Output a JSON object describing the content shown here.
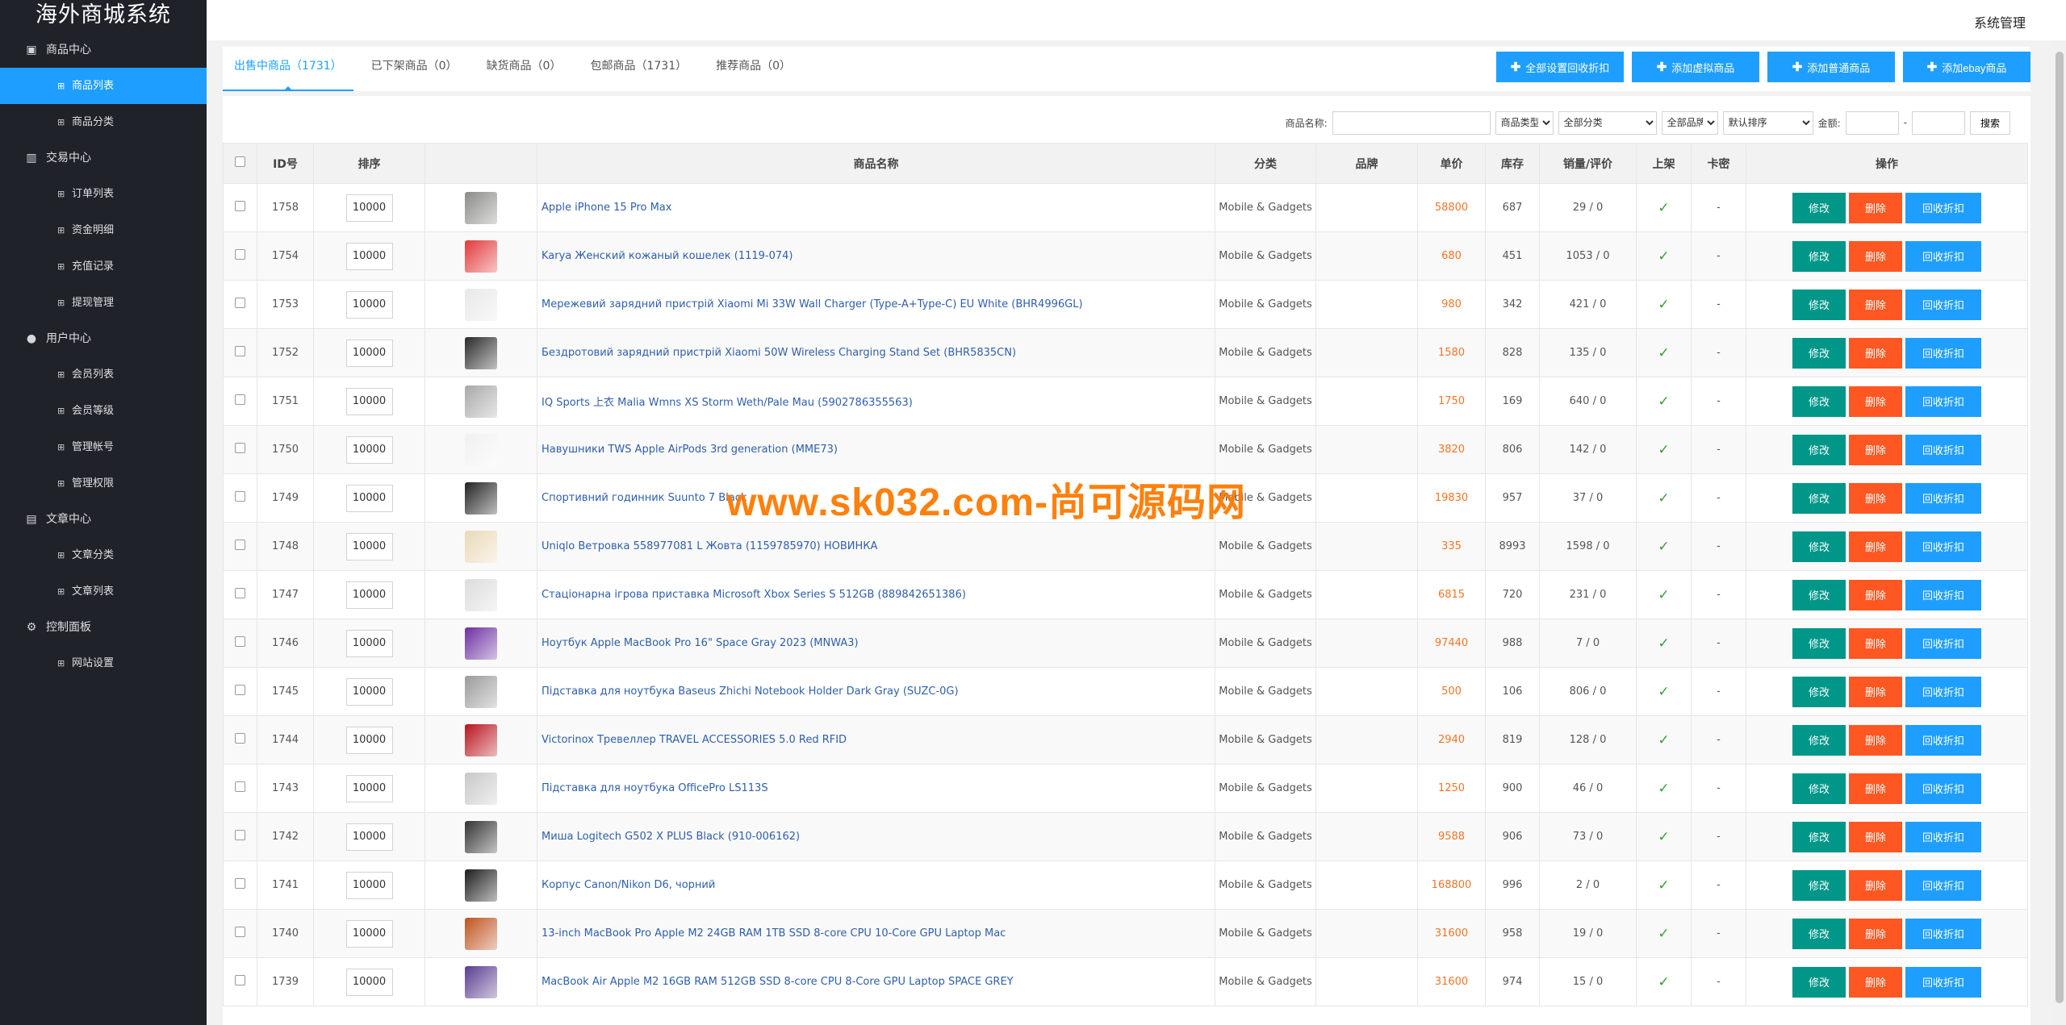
{
  "app": {
    "title": "海外商城系统",
    "sys_admin": "系统管理"
  },
  "sidebar": [
    {
      "title": "商品中心",
      "icon": "goods-icon",
      "glyph": "▣",
      "items": [
        "商品列表",
        "商品分类"
      ]
    },
    {
      "title": "交易中心",
      "icon": "chart-icon",
      "glyph": "▥",
      "items": [
        "订单列表",
        "资金明细",
        "充值记录",
        "提现管理"
      ]
    },
    {
      "title": "用户中心",
      "icon": "user-icon",
      "glyph": "●",
      "items": [
        "会员列表",
        "会员等级",
        "管理帐号",
        "管理权限"
      ]
    },
    {
      "title": "文章中心",
      "icon": "document-icon",
      "glyph": "▤",
      "items": [
        "文章分类",
        "文章列表"
      ]
    },
    {
      "title": "控制面板",
      "icon": "gear-icon",
      "glyph": "⚙",
      "items": [
        "网站设置"
      ]
    }
  ],
  "active_item": "商品列表",
  "tabs": [
    "出售中商品（1731）",
    "已下架商品（0）",
    "缺货商品（0）",
    "包邮商品（1731）",
    "推荐商品（0）"
  ],
  "top_buttons": [
    "全部设置回收折扣",
    "添加虚拟商品",
    "添加普通商品",
    "添加ebay商品"
  ],
  "filter": {
    "name_label": "商品名称:",
    "name_value": "",
    "type_select": "商品类型",
    "category_select": "全部分类",
    "brand_select": "全部品牌",
    "sort_select": "默认排序",
    "amount_label": "金额:",
    "amount_min": "",
    "amount_sep": "-",
    "amount_max": "",
    "search_button": "搜索"
  },
  "table": {
    "headers": [
      "",
      "ID号",
      "排序",
      "",
      "商品名称",
      "分类",
      "品牌",
      "单价",
      "库存",
      "销量/评价",
      "上架",
      "卡密",
      "操作"
    ],
    "action_labels": {
      "edit": "修改",
      "delete": "删除",
      "recycle": "回收折扣"
    },
    "rows": [
      {
        "id": "1758",
        "sort": "10000",
        "name": "Apple iPhone 15 Pro Max",
        "category": "Mobile & Gadgets",
        "brand": "",
        "price": "58800",
        "stock": "687",
        "sales": "29 / 0",
        "card": "-",
        "thumb_color": "#8a8a86"
      },
      {
        "id": "1754",
        "sort": "10000",
        "name": "Karya Женский кожаный кошелек (1119-074)",
        "category": "Mobile & Gadgets",
        "brand": "",
        "price": "680",
        "stock": "451",
        "sales": "1053 / 0",
        "card": "-",
        "thumb_color": "#e03a3a"
      },
      {
        "id": "1753",
        "sort": "10000",
        "name": "Мережевий зарядний пристрій Xiaomi Mi 33W Wall Charger (Type-A+Type-C) EU White (BHR4996GL)",
        "category": "Mobile & Gadgets",
        "brand": "",
        "price": "980",
        "stock": "342",
        "sales": "421 / 0",
        "card": "-",
        "thumb_color": "#e8e8e8"
      },
      {
        "id": "1752",
        "sort": "10000",
        "name": "Бездротовий зарядний пристрій Xiaomi 50W Wireless Charging Stand Set (BHR5835CN)",
        "category": "Mobile & Gadgets",
        "brand": "",
        "price": "1580",
        "stock": "828",
        "sales": "135 / 0",
        "card": "-",
        "thumb_color": "#2a2a2a"
      },
      {
        "id": "1751",
        "sort": "10000",
        "name": "IQ Sports 上衣 Malia Wmns XS Storm Weth/Pale Mau (5902786355563)",
        "category": "Mobile & Gadgets",
        "brand": "",
        "price": "1750",
        "stock": "169",
        "sales": "640 / 0",
        "card": "-",
        "thumb_color": "#a9a9a9"
      },
      {
        "id": "1750",
        "sort": "10000",
        "name": "Навушники TWS Apple AirPods 3rd generation (MME73)",
        "category": "Mobile & Gadgets",
        "brand": "",
        "price": "3820",
        "stock": "806",
        "sales": "142 / 0",
        "card": "-",
        "thumb_color": "#f1f1f1"
      },
      {
        "id": "1749",
        "sort": "10000",
        "name": "Спортивний годинник Suunto 7 Black",
        "category": "Mobile & Gadgets",
        "brand": "",
        "price": "19830",
        "stock": "957",
        "sales": "37 / 0",
        "card": "-",
        "thumb_color": "#222222"
      },
      {
        "id": "1748",
        "sort": "10000",
        "name": "Uniqlo Ветровка 558977081 L Жовта (1159785970) НОВИНКА",
        "category": "Mobile & Gadgets",
        "brand": "",
        "price": "335",
        "stock": "8993",
        "sales": "1598 / 0",
        "card": "-",
        "thumb_color": "#e9d9b8"
      },
      {
        "id": "1747",
        "sort": "10000",
        "name": "Стаціонарна ігрова приставка Microsoft Xbox Series S 512GB (889842651386)",
        "category": "Mobile & Gadgets",
        "brand": "",
        "price": "6815",
        "stock": "720",
        "sales": "231 / 0",
        "card": "-",
        "thumb_color": "#dcdcdc"
      },
      {
        "id": "1746",
        "sort": "10000",
        "name": "Ноутбук Apple MacBook Pro 16\" Space Gray 2023 (MNWA3)",
        "category": "Mobile & Gadgets",
        "brand": "",
        "price": "97440",
        "stock": "988",
        "sales": "7 / 0",
        "card": "-",
        "thumb_color": "#6b2fa0"
      },
      {
        "id": "1745",
        "sort": "10000",
        "name": "Підставка для ноутбука Baseus Zhichi Notebook Holder Dark Gray (SUZC-0G)",
        "category": "Mobile & Gadgets",
        "brand": "",
        "price": "500",
        "stock": "106",
        "sales": "806 / 0",
        "card": "-",
        "thumb_color": "#9a9a9a"
      },
      {
        "id": "1744",
        "sort": "10000",
        "name": "Victorinox Тревеллер TRAVEL ACCESSORIES 5.0 Red RFID",
        "category": "Mobile & Gadgets",
        "brand": "",
        "price": "2940",
        "stock": "819",
        "sales": "128 / 0",
        "card": "-",
        "thumb_color": "#b8141c"
      },
      {
        "id": "1743",
        "sort": "10000",
        "name": "Підставка для ноутбука OfficePro LS113S",
        "category": "Mobile & Gadgets",
        "brand": "",
        "price": "1250",
        "stock": "900",
        "sales": "46 / 0",
        "card": "-",
        "thumb_color": "#c8c8c8"
      },
      {
        "id": "1742",
        "sort": "10000",
        "name": "Миша Logitech G502 X PLUS Black (910-006162)",
        "category": "Mobile & Gadgets",
        "brand": "",
        "price": "9588",
        "stock": "906",
        "sales": "73 / 0",
        "card": "-",
        "thumb_color": "#333333"
      },
      {
        "id": "1741",
        "sort": "10000",
        "name": "Корпус Canon/Nikon D6, чорний",
        "category": "Mobile & Gadgets",
        "brand": "",
        "price": "168800",
        "stock": "996",
        "sales": "2 / 0",
        "card": "-",
        "thumb_color": "#1d1d1d"
      },
      {
        "id": "1740",
        "sort": "10000",
        "name": "13-inch MacBook Pro Apple M2 24GB RAM 1TB SSD 8-core CPU 10-Core GPU Laptop Mac",
        "category": "Mobile & Gadgets",
        "brand": "",
        "price": "31600",
        "stock": "958",
        "sales": "19 / 0",
        "card": "-",
        "thumb_color": "#c0531f"
      },
      {
        "id": "1739",
        "sort": "10000",
        "name": "MacBook Air Apple M2 16GB RAM 512GB SSD 8-core CPU 8-Core GPU Laptop SPACE GREY",
        "category": "Mobile & Gadgets",
        "brand": "",
        "price": "31600",
        "stock": "974",
        "sales": "15 / 0",
        "card": "-",
        "thumb_color": "#5a3d8f"
      }
    ]
  },
  "watermark": "www.sk032.com-尚可源码网",
  "colors": {
    "sidebar_bg": "#20222a",
    "accent": "#1e9fff",
    "edit": "#009688",
    "delete": "#ff5722",
    "price": "#f0762a"
  }
}
